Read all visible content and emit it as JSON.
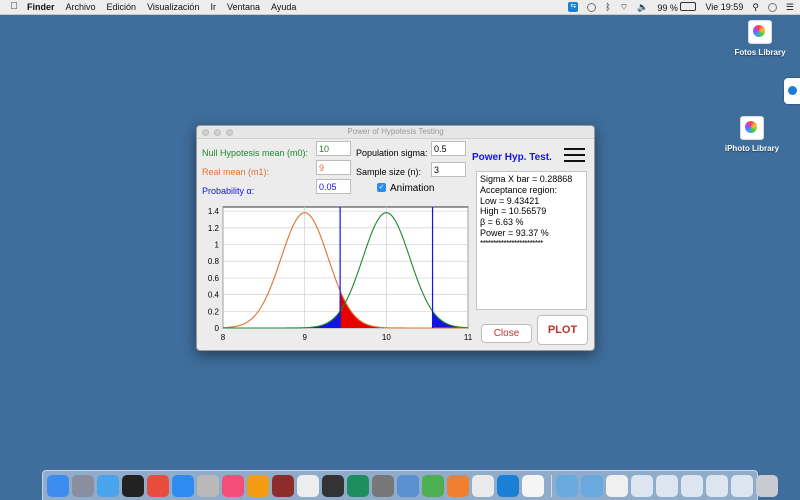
{
  "menubar": {
    "apple": "",
    "items": [
      "Finder",
      "Archivo",
      "Edición",
      "Visualización",
      "Ir",
      "Ventana",
      "Ayuda"
    ],
    "battery": "99 %",
    "clock": "Vie 19:59"
  },
  "desktop": {
    "icon1_label": "Fotos Library",
    "icon2_label": "iPhoto Library"
  },
  "window": {
    "title": "Power of Hypotesis Testing",
    "null_mean_label": "Null Hypotesis mean (m0):",
    "null_mean_value": "10",
    "real_mean_label": "Real mean (m1):",
    "real_mean_value": "9",
    "alpha_label": "Probability α:",
    "alpha_value": "0.05",
    "sigma_label": "Population sigma:",
    "sigma_value": "0.5",
    "n_label": "Sample size (n):",
    "n_value": "3",
    "animation_label": "Animation",
    "animation_checked": true,
    "heading": "Power Hyp. Test.",
    "results": [
      "Sigma X bar = 0.28868",
      "Acceptance region:",
      "Low = 9.43421",
      "High = 10.56579",
      "β = 6.63 %",
      "Power = 93.37 %",
      "************************"
    ],
    "close_label": "Close",
    "plot_label": "PLOT"
  },
  "colors": {
    "green": "#1a8a2a",
    "orange": "#e0722d",
    "blue": "#1414e6",
    "red": "#e60000",
    "desktop": "#3f6e9c"
  },
  "chart_data": {
    "type": "line",
    "xlim": [
      8,
      11
    ],
    "ylim": [
      0,
      1.45
    ],
    "x_ticks": [
      "8",
      "9",
      "10",
      "11"
    ],
    "y_ticks": [
      "0",
      "0.2",
      "0.4",
      "0.6",
      "0.8",
      "1",
      "1.2",
      "1.4"
    ],
    "grid": true,
    "series": [
      {
        "mean": 9,
        "sd": 0.28868,
        "color": "#e0722d"
      },
      {
        "mean": 10,
        "sd": 0.28868,
        "color": "#1a8a2a"
      }
    ],
    "acceptance_low": 9.43421,
    "acceptance_high": 10.56579
  }
}
